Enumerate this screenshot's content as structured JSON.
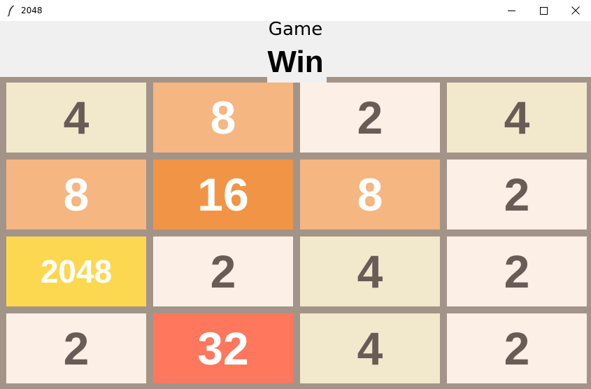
{
  "window": {
    "title": "2048"
  },
  "header": {
    "game_label": "Game",
    "status_label": "Win"
  },
  "board": {
    "rows": [
      [
        4,
        8,
        2,
        4
      ],
      [
        8,
        16,
        8,
        2
      ],
      [
        2048,
        2,
        4,
        2
      ],
      [
        2,
        32,
        4,
        2
      ]
    ]
  },
  "colors": {
    "board_background": "#a39489",
    "tile_2": "#fcefe6",
    "tile_4": "#f2e8cb",
    "tile_8": "#f5b682",
    "tile_16": "#f29446",
    "tile_32": "#ff775c",
    "tile_2048": "#fcd850",
    "text_dark": "#695c57",
    "text_light": "#ffffff"
  }
}
